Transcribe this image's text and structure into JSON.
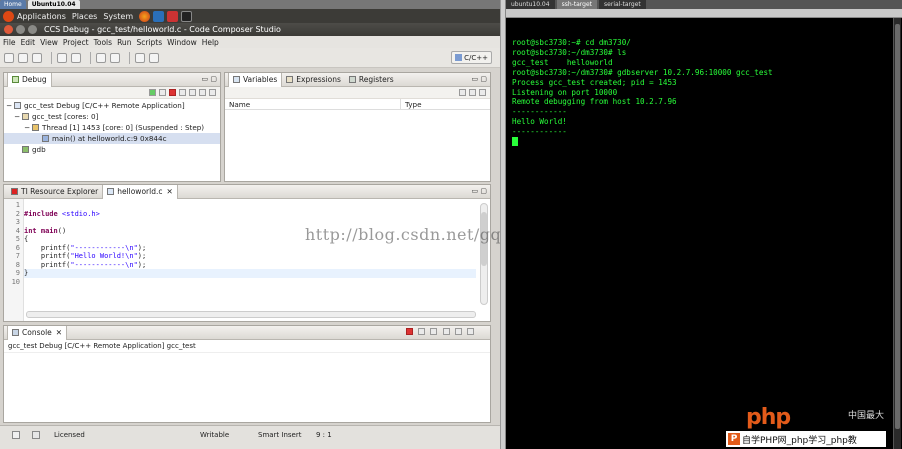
{
  "host_tabs": [
    "Home",
    "Ubuntu10.04"
  ],
  "gnome_panel": {
    "applications": "Applications",
    "places": "Places",
    "system": "System"
  },
  "window": {
    "title": "CCS Debug - gcc_test/helloworld.c - Code Composer Studio"
  },
  "menu": [
    "File",
    "Edit",
    "View",
    "Project",
    "Tools",
    "Run",
    "Scripts",
    "Window",
    "Help"
  ],
  "perspective": "C/C++",
  "debug_view": {
    "tab": "Debug",
    "tree": [
      {
        "text": "gcc_test Debug [C/C++ Remote Application]",
        "level": 0
      },
      {
        "text": "gcc_test [cores: 0]",
        "level": 1
      },
      {
        "text": "Thread [1] 1453 [core: 0] (Suspended : Step)",
        "level": 2
      },
      {
        "text": "main() at helloworld.c:9 0x844c",
        "level": 3
      },
      {
        "text": "gdb",
        "level": 1
      }
    ]
  },
  "variables_view": {
    "tabs": [
      "Variables",
      "Expressions",
      "Registers"
    ],
    "columns": [
      "Name",
      "Type"
    ]
  },
  "editor": {
    "tabs": [
      "TI Resource Explorer",
      "helloworld.c"
    ],
    "lines": [
      {
        "n": "1",
        "parts": []
      },
      {
        "n": "2",
        "parts": [
          {
            "c": "kw",
            "t": "#include"
          },
          {
            "c": "str",
            "t": " <stdio.h>"
          }
        ]
      },
      {
        "n": "3",
        "parts": []
      },
      {
        "n": "4",
        "parts": [
          {
            "c": "kw",
            "t": "int"
          },
          {
            "c": "fn",
            "t": " "
          },
          {
            "c": "kw",
            "t": "main"
          },
          {
            "c": "fn",
            "t": "()"
          }
        ]
      },
      {
        "n": "5",
        "parts": [
          {
            "c": "fn",
            "t": "{"
          }
        ]
      },
      {
        "n": "6",
        "parts": [
          {
            "c": "fn",
            "t": "    printf("
          },
          {
            "c": "str",
            "t": "\"------------\\n\""
          },
          {
            "c": "fn",
            "t": ");"
          }
        ]
      },
      {
        "n": "7",
        "parts": [
          {
            "c": "fn",
            "t": "    printf("
          },
          {
            "c": "str",
            "t": "\"Hello World!\\n\""
          },
          {
            "c": "fn",
            "t": ");"
          }
        ]
      },
      {
        "n": "8",
        "parts": [
          {
            "c": "fn",
            "t": "    printf("
          },
          {
            "c": "str",
            "t": "\"------------\\n\""
          },
          {
            "c": "fn",
            "t": ");"
          }
        ]
      },
      {
        "n": "9",
        "parts": [
          {
            "c": "fn",
            "t": "}"
          }
        ]
      },
      {
        "n": "10",
        "parts": []
      }
    ]
  },
  "watermark": "http://blog.csdn.net/gqb_driver",
  "console": {
    "tab": "Console",
    "label": "gcc_test Debug [C/C++ Remote Application] gcc_test"
  },
  "status": {
    "licensed": "Licensed",
    "writable": "Writable",
    "insert": "Smart Insert",
    "pos": "9 : 1"
  },
  "terminal": {
    "tabs": [
      "ubuntu10.04",
      "ssh-target",
      "serial-target"
    ],
    "lines": [
      "root@sbc3730:~# cd dm3730/",
      "root@sbc3730:~/dm3730# ls",
      "gcc_test    helloworld",
      "root@sbc3730:~/dm3730# gdbserver 10.2.7.96:10000 gcc_test",
      "Process gcc_test created; pid = 1453",
      "Listening on port 10000",
      "Remote debugging from host 10.2.7.96",
      "------------",
      "Hello World!",
      "------------"
    ]
  },
  "logo": {
    "big": "php",
    "cn": "中国最大",
    "bar_text": "自学PHP网_php学习_php教",
    "p_letter": "P"
  },
  "colors": {
    "terminal_text": "#29ff3a",
    "terminal_bg": "#000000",
    "keyword": "#7f0055",
    "string": "#2a00ff"
  }
}
